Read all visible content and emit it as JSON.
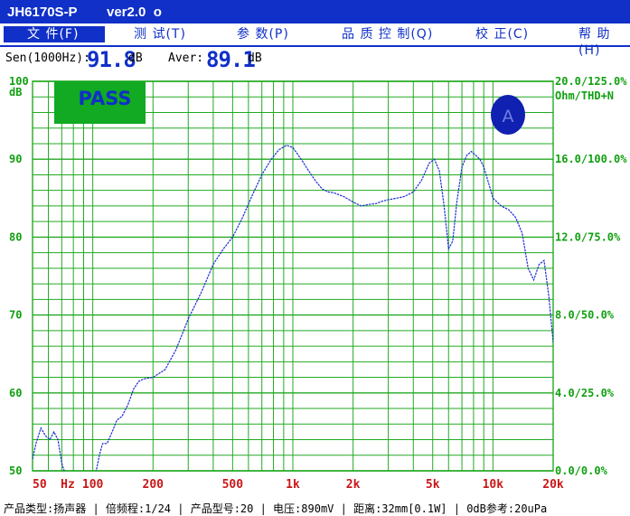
{
  "titlebar": {
    "app": "JH6170S-P",
    "version": "ver2.0",
    "marker": "o"
  },
  "menu": [
    {
      "label": "文 件(F)",
      "active": true
    },
    {
      "label": "测 试(T)",
      "active": false
    },
    {
      "label": "参 数(P)",
      "active": false
    },
    {
      "label": "品 质 控 制(Q)",
      "active": false
    },
    {
      "label": "校 正(C)",
      "active": false
    },
    {
      "label": "帮 助(H)",
      "active": false
    }
  ],
  "readout": {
    "sen_label": "Sen(1000Hz):",
    "sen_value": "91.8",
    "sen_unit": "dB",
    "aver_label": "Aver:",
    "aver_value": "89.1",
    "aver_unit": "dB"
  },
  "badges": {
    "pass": "PASS",
    "channel": "A"
  },
  "status_bar": "产品类型:扬声器 | 倍频程:1/24 | 产品型号:20 | 电压:890mV | 距离:32mm[0.1W] | 0dB参考:20uPa",
  "colors": {
    "accent": "#1030c8",
    "grid": "#22aa22",
    "curve": "#1a2fd0",
    "pass": "#11aa22",
    "xaxis": "#c81818"
  },
  "chart_data": {
    "type": "line",
    "x_scale": "log",
    "xlim": [
      50,
      20000
    ],
    "ylim": [
      50,
      100
    ],
    "y_ticks": [
      "100",
      "90",
      "80",
      "70",
      "60",
      "50"
    ],
    "y_unit": "dB",
    "x_ticks": [
      "50",
      "Hz",
      "100",
      "200",
      "500",
      "1k",
      "2k",
      "5k",
      "10k",
      "20k"
    ],
    "right_ticks": [
      "20.0/125.0%",
      "16.0/100.0%",
      "12.0/75.0%",
      "8.0/50.0%",
      "4.0/25.0%",
      "0.0/0.0%"
    ],
    "right_unit": "Ohm/THD+N",
    "series": [
      {
        "x": [
          50,
          52,
          55,
          58,
          61,
          64,
          67,
          70,
          73,
          76,
          80,
          85,
          90,
          95,
          100,
          104,
          108,
          112,
          118,
          125,
          132,
          140,
          150,
          160,
          170,
          180,
          200,
          230,
          260,
          300,
          350,
          400,
          450,
          500,
          560,
          630,
          700,
          780,
          850,
          930,
          1000,
          1100,
          1200,
          1300,
          1400,
          1500,
          1600,
          1800,
          2000,
          2200,
          2400,
          2600,
          2800,
          3000,
          3300,
          3600,
          4000,
          4400,
          4800,
          5100,
          5400,
          5700,
          6000,
          6300,
          6600,
          7000,
          7400,
          7800,
          8200,
          8600,
          9000,
          9500,
          10000,
          11000,
          12000,
          13000,
          14000,
          15000,
          16000,
          17000,
          18000,
          19000,
          20000
        ],
        "y": [
          51.5,
          53.5,
          55.5,
          54.5,
          54.0,
          55.0,
          54.0,
          51.0,
          49.5,
          49.0,
          49.0,
          48.5,
          48.5,
          48.5,
          49.0,
          50.0,
          52.0,
          53.5,
          53.5,
          55.0,
          56.5,
          57.0,
          58.5,
          60.5,
          61.5,
          61.8,
          62.0,
          63.0,
          65.5,
          69.5,
          73.0,
          76.5,
          78.5,
          80.0,
          82.5,
          85.5,
          88.0,
          90.0,
          91.2,
          91.8,
          91.5,
          90.0,
          88.5,
          87.2,
          86.2,
          85.8,
          85.7,
          85.2,
          84.5,
          84.0,
          84.2,
          84.3,
          84.6,
          84.8,
          85.0,
          85.2,
          85.8,
          87.3,
          89.5,
          90.0,
          88.5,
          84.0,
          78.5,
          79.5,
          84.5,
          89.0,
          90.5,
          91.0,
          90.5,
          90.0,
          89.0,
          87.0,
          85.0,
          84.0,
          83.5,
          82.5,
          80.5,
          76.0,
          74.5,
          76.5,
          77.0,
          72.5,
          66.5
        ]
      }
    ]
  }
}
